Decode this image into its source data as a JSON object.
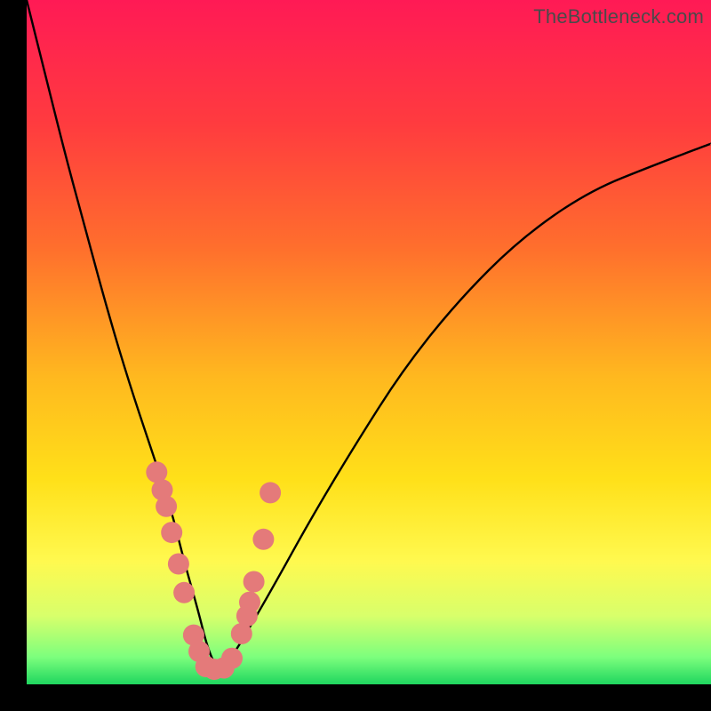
{
  "watermark": "TheBottleneck.com",
  "chart_data": {
    "type": "line",
    "title": "",
    "xlabel": "",
    "ylabel": "",
    "xlim": [
      0,
      100
    ],
    "ylim": [
      0,
      100
    ],
    "grid": false,
    "legend": false,
    "description": "V-shaped curve over a vertical green→yellow→orange→red gradient, with scattered pink data points clustered near the curve's minimum.",
    "curve": {
      "x": [
        0,
        3,
        6,
        9,
        12,
        15,
        18,
        21,
        23,
        25,
        26.5,
        28,
        30,
        33,
        37,
        42,
        48,
        55,
        63,
        72,
        82,
        92,
        100
      ],
      "y": [
        100,
        88,
        76,
        65,
        54,
        44,
        35,
        26,
        18,
        11,
        5,
        2,
        4,
        9,
        16,
        25,
        35,
        46,
        56,
        65,
        72,
        76,
        79
      ]
    },
    "series": [
      {
        "name": "data-points",
        "type": "scatter",
        "x": [
          19.0,
          19.8,
          20.4,
          21.2,
          22.2,
          23.0,
          24.4,
          25.2,
          26.2,
          27.4,
          28.8,
          30.0,
          31.4,
          32.2,
          32.6,
          33.2,
          34.6,
          35.6
        ],
        "y": [
          31.0,
          28.4,
          26.0,
          22.2,
          17.6,
          13.4,
          7.2,
          4.8,
          2.6,
          2.2,
          2.4,
          3.8,
          7.4,
          10.0,
          12.0,
          15.0,
          21.2,
          28.0
        ]
      }
    ],
    "point_style": {
      "radius": 12,
      "fill": "#e47a7a"
    },
    "gradient_stops": [
      {
        "offset": 0,
        "color": "#ff1a55"
      },
      {
        "offset": 0.18,
        "color": "#ff3b3f"
      },
      {
        "offset": 0.36,
        "color": "#ff6e2d"
      },
      {
        "offset": 0.55,
        "color": "#ffb81f"
      },
      {
        "offset": 0.7,
        "color": "#ffe019"
      },
      {
        "offset": 0.82,
        "color": "#fff94f"
      },
      {
        "offset": 0.9,
        "color": "#d8ff6b"
      },
      {
        "offset": 0.96,
        "color": "#7dff7d"
      },
      {
        "offset": 1.0,
        "color": "#1fd65f"
      }
    ]
  }
}
